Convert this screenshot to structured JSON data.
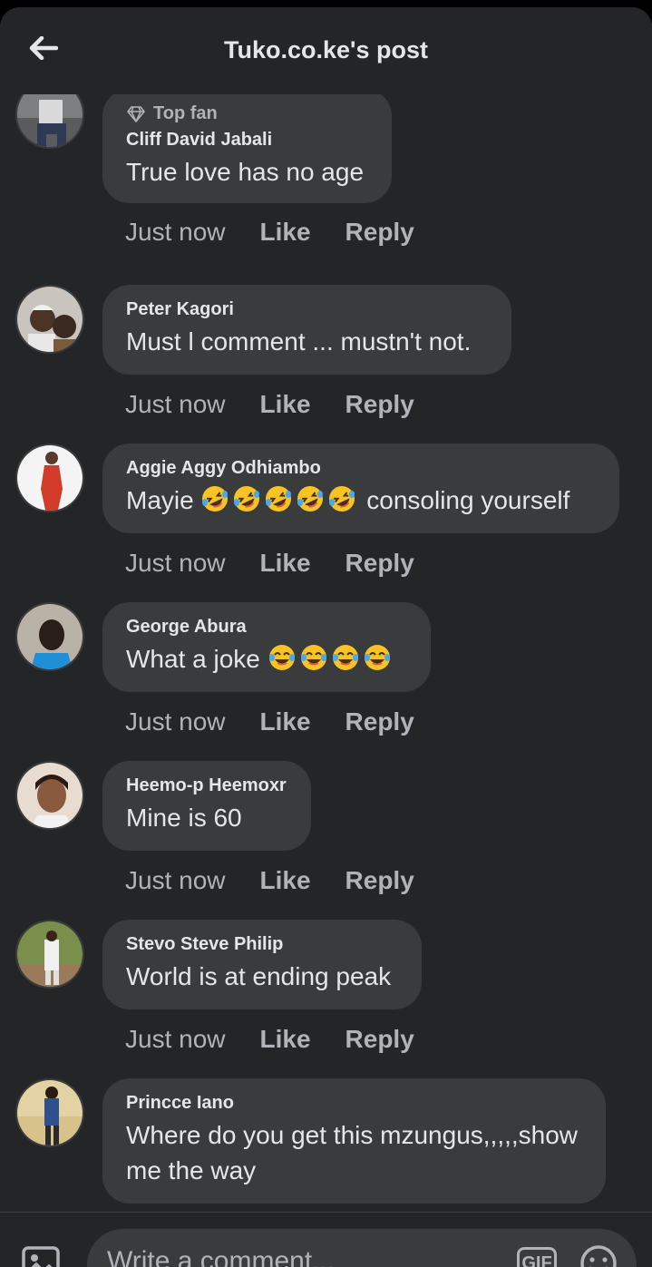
{
  "header": {
    "title": "Tuko.co.ke's post",
    "back_icon": "arrow-left-icon"
  },
  "comments": [
    {
      "badge": "Top fan",
      "badge_icon": "diamond-icon",
      "name": "Cliff David Jabali",
      "text": "True love has no age",
      "time": "Just now",
      "like": "Like",
      "reply": "Reply"
    },
    {
      "name": "Peter Kagori",
      "text": "Must l comment ... mustn't not.",
      "time": "Just now",
      "like": "Like",
      "reply": "Reply"
    },
    {
      "name": "Aggie Aggy Odhiambo",
      "text_before": "Mayie",
      "emojis": [
        "rolling-on-floor-laughing-emoji",
        "rolling-on-floor-laughing-emoji",
        "rolling-on-floor-laughing-emoji",
        "rolling-on-floor-laughing-emoji",
        "rolling-on-floor-laughing-emoji"
      ],
      "text_after": "consoling yourself",
      "time": "Just now",
      "like": "Like",
      "reply": "Reply"
    },
    {
      "name": "George Abura",
      "text_before": "What a joke",
      "emojis": [
        "tears-of-joy-emoji",
        "tears-of-joy-emoji",
        "tears-of-joy-emoji",
        "tears-of-joy-emoji"
      ],
      "time": "Just now",
      "like": "Like",
      "reply": "Reply"
    },
    {
      "name": "Heemo-p Heemoxr",
      "text": "Mine is 60",
      "time": "Just now",
      "like": "Like",
      "reply": "Reply"
    },
    {
      "name": "Stevo Steve Philip",
      "text": "World is at ending peak",
      "time": "Just now",
      "like": "Like",
      "reply": "Reply"
    },
    {
      "name": "Princce Iano",
      "text_line1": "Where do you get this mzungus,,,,,show",
      "text_line2": "me the way"
    }
  ],
  "composer": {
    "placeholder": "Write a comment...",
    "gif_label": "GIF",
    "photo_icon": "photo-icon",
    "emoji_icon": "smiley-icon"
  },
  "colors": {
    "background": "#242526",
    "bubble": "#3a3b3c",
    "primary_text": "#e4e6eb",
    "secondary_text": "#b0b3b8"
  }
}
